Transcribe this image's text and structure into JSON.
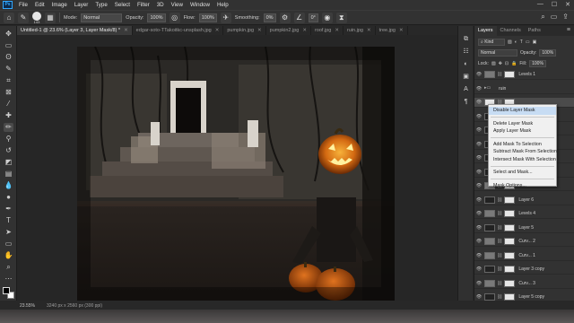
{
  "app": {
    "menu": [
      "File",
      "Edit",
      "Image",
      "Layer",
      "Type",
      "Select",
      "Filter",
      "3D",
      "View",
      "Window",
      "Help"
    ],
    "window_controls": [
      "—",
      "☐",
      "✕"
    ]
  },
  "options_bar": {
    "brush_size": "143",
    "mode_label": "Mode:",
    "mode_value": "Normal",
    "opacity_label": "Opacity:",
    "opacity_value": "100%",
    "flow_label": "Flow:",
    "flow_value": "100%",
    "smoothing_label": "Smoothing:",
    "smoothing_value": "0%",
    "angle_value": "0°"
  },
  "tabs": [
    {
      "label": "Untitled-1 @ 23.6% (Layer 3, Layer Mask/8) *"
    },
    {
      "label": "edgar-soto-TTakoitkc-unsplash.jpg"
    },
    {
      "label": "pumpkin.jpg"
    },
    {
      "label": "pumpkin2.jpg"
    },
    {
      "label": "roof.jpg"
    },
    {
      "label": "ruin.jpg"
    },
    {
      "label": "tree.jpg"
    }
  ],
  "status": {
    "zoom": "23.55%",
    "doc_info": "3240 px x 2560 px (300 ppi)"
  },
  "layers_panel": {
    "tabs": [
      "Layers",
      "Channels",
      "Paths"
    ],
    "kind_label": "Kind",
    "blend_mode": "Normal",
    "opacity_label": "Opacity:",
    "opacity_value": "100%",
    "lock_label": "Lock:",
    "fill_label": "Fill:",
    "fill_value": "100%",
    "rows": [
      {
        "name": "Levels 1",
        "thumb": "adj"
      },
      {
        "name": "ruin",
        "thumb": "folder"
      },
      {
        "name": "",
        "thumb": "light",
        "selected": true
      },
      {
        "name": "",
        "thumb": "dark"
      },
      {
        "name": "",
        "thumb": "dark"
      },
      {
        "name": "",
        "thumb": "dark"
      },
      {
        "name": "",
        "thumb": "dark"
      },
      {
        "name": "",
        "thumb": "dark"
      },
      {
        "name": "Levels 3",
        "thumb": "adj"
      },
      {
        "name": "Layer 6",
        "thumb": "dark"
      },
      {
        "name": "Levels 4",
        "thumb": "adj"
      },
      {
        "name": "Layer 5",
        "thumb": "dark"
      },
      {
        "name": "Curv... 2",
        "thumb": "adj"
      },
      {
        "name": "Curv... 1",
        "thumb": "adj"
      },
      {
        "name": "Layer 3 copy",
        "thumb": "dark"
      },
      {
        "name": "Curv... 3",
        "thumb": "adj"
      },
      {
        "name": "Layer 5 copy",
        "thumb": "dark"
      }
    ]
  },
  "context_menu": {
    "groups": [
      [
        "Disable Layer Mask",
        "Delete Layer Mask",
        "Apply Layer Mask"
      ],
      [
        "Add Mask To Selection",
        "Subtract Mask From Selection",
        "Intersect Mask With Selection"
      ],
      [
        "Select and Mask..."
      ],
      [
        "Mask Options..."
      ]
    ]
  }
}
